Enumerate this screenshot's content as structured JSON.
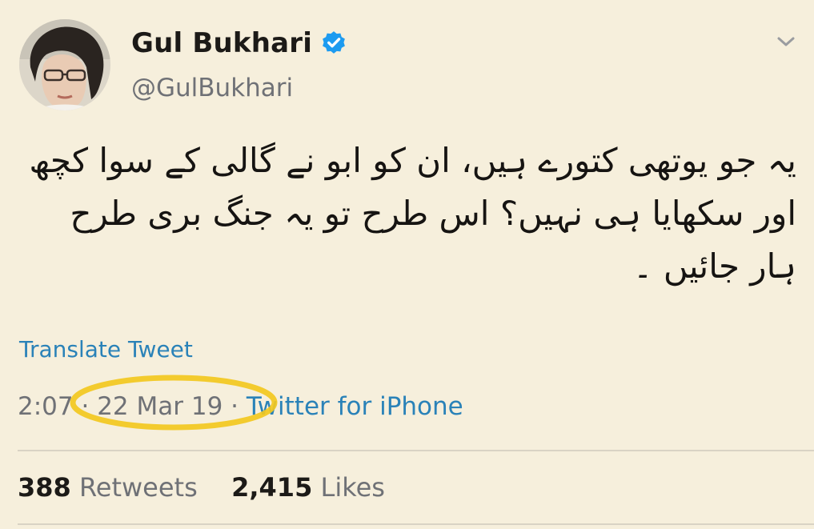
{
  "author": {
    "display_name": "Gul Bukhari",
    "handle": "@GulBukhari",
    "verified": true
  },
  "tweet": {
    "text": "یہ جو یوتھی کتورے ہیں، ان کو ابو نے گالی کے سوا کچھ اور سکھایا ہی نہیں؟ اس طرح تو یہ جنگ بری طرح ہار جائیں ۔",
    "translate_label": "Translate Tweet",
    "time": "2:07",
    "separator": "·",
    "date": "22 Mar 19",
    "source": "Twitter for iPhone"
  },
  "stats": {
    "retweets_count": "388",
    "retweets_label": "Retweets",
    "likes_count": "2,415",
    "likes_label": "Likes"
  },
  "icons": {
    "verified": "verified-badge-icon",
    "caret": "chevron-down-icon"
  },
  "colors": {
    "background": "#f6efdc",
    "link": "#2a82b8",
    "verified": "#1d9bf0",
    "highlight": "#f2c81e"
  }
}
